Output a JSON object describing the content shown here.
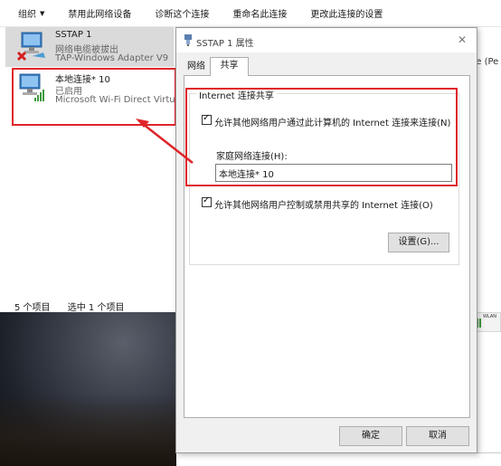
{
  "toolbar": {
    "items": [
      {
        "label": "组织",
        "has_dropdown": true
      },
      {
        "label": "禁用此网络设备"
      },
      {
        "label": "诊断这个连接"
      },
      {
        "label": "重命名此连接"
      },
      {
        "label": "更改此连接的设置"
      }
    ]
  },
  "connections": [
    {
      "name": "SSTAP 1",
      "status": "网络电缆被拔出",
      "adapter": "TAP-Windows Adapter V9",
      "icon": "network-disconnected-icon"
    },
    {
      "name": "本地连接* 10",
      "status": "已启用",
      "adapter": "Microsoft Wi-Fi Direct Virtual",
      "icon": "wifi-network-icon"
    }
  ],
  "statusbar": {
    "count": "5 个项目",
    "selected": "选中 1 个项目"
  },
  "background": {
    "right_text": "ice (Pe",
    "wlan_label": "WLAN"
  },
  "dialog": {
    "title": "SSTAP 1 属性",
    "tabs": {
      "network": "网络",
      "sharing": "共享"
    },
    "group_title": "Internet 连接共享",
    "allow_share_label": "允许其他网络用户通过此计算机的 Internet 连接来连接(N)",
    "allow_share_checked": true,
    "home_network_label": "家庭网络连接(H):",
    "home_network_value": "本地连接* 10",
    "allow_control_label": "允许其他网络用户控制或禁用共享的 Internet 连接(O)",
    "allow_control_checked": true,
    "settings_button": "设置(G)...",
    "ok_button": "确定",
    "cancel_button": "取消"
  },
  "colors": {
    "highlight_red": "#e0252a",
    "selected_row": "#dadada",
    "dialog_bg": "#f0f0f0"
  }
}
